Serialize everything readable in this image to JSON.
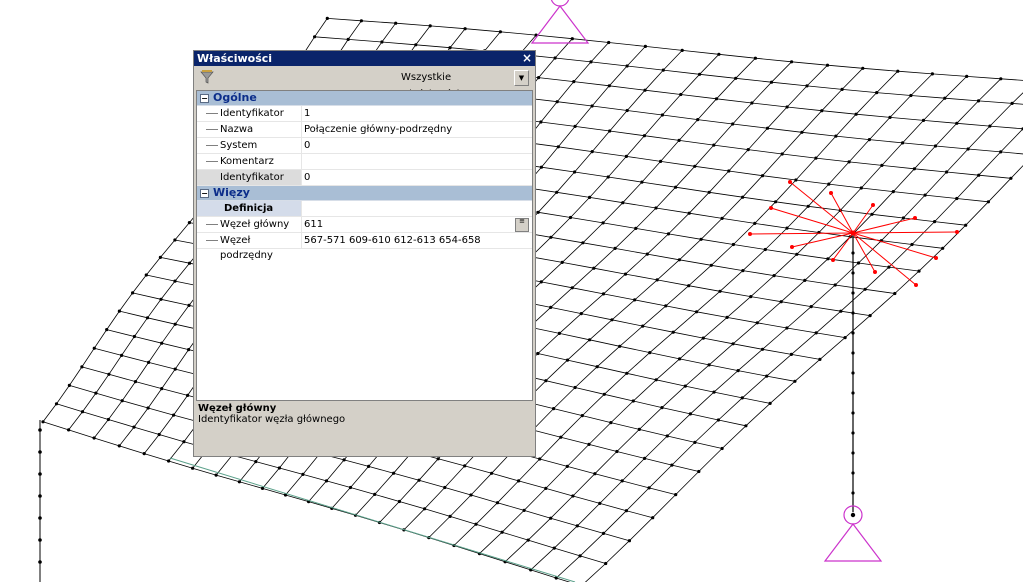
{
  "panel": {
    "title": "Właściwości",
    "close_glyph": "×",
    "filter_icon": "filter-icon",
    "dropdown_value": "Wszystkie właściwości",
    "dropdown_arrow": "▼",
    "categories": [
      {
        "label": "Ogólne",
        "toggle": "−",
        "rows": [
          {
            "name": "Identyfikator",
            "value": "1"
          },
          {
            "name": "Nazwa",
            "value": "Połączenie główny-podrzędny"
          },
          {
            "name": "System",
            "value": "0"
          },
          {
            "name": "Komentarz",
            "value": ""
          },
          {
            "name": "Identyfikator GTC",
            "value": "0"
          }
        ]
      },
      {
        "label": "Więzy",
        "toggle": "−",
        "subgroup": {
          "label": "Definicja",
          "toggle": "+"
        },
        "rows": [
          {
            "name": "Węzeł główny",
            "value": "611"
          },
          {
            "name": "Węzeł podrzędny",
            "value": "567-571 609-610 612-613 654-658"
          }
        ]
      }
    ],
    "description": {
      "title": "Węzeł główny",
      "text": "Identyfikator węzła głównego"
    }
  },
  "colors": {
    "mesh_line": "#000000",
    "rigid_link": "#ff0000",
    "support": "#cc33cc",
    "edge_green": "#5aa08a",
    "titlebar": "#0a246a",
    "category_bg": "#a9bed5"
  }
}
